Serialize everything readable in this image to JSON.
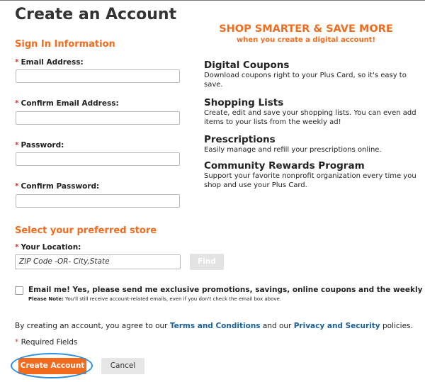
{
  "page": {
    "title": "Create an Account"
  },
  "sign_in": {
    "title": "Sign In Information",
    "email_label": "Email Address:",
    "confirm_email_label": "Confirm Email Address:",
    "password_label": "Password:",
    "confirm_password_label": "Confirm Password:"
  },
  "promo": {
    "headline": "SHOP SMARTER & SAVE MORE",
    "subheadline": "when you create a digital account!",
    "benefits": [
      {
        "title": "Digital Coupons",
        "text": "Download coupons right to your Plus Card, so it's easy to save."
      },
      {
        "title": "Shopping Lists",
        "text": "Create, edit and save your shopping lists. You can even add items to your lists from the weekly ad!"
      },
      {
        "title": "Prescriptions",
        "text": "Easily manage and refill your prescriptions online."
      },
      {
        "title": "Community Rewards Program",
        "text": "Support your favorite nonprofit organization every time you shop and use your Plus Card."
      }
    ]
  },
  "store": {
    "title": "Select your preferred store",
    "location_label": "Your Location:",
    "location_placeholder": "ZIP Code -OR- City,State",
    "find_label": "Find"
  },
  "email_opt": {
    "label": "Email me! Yes, please send me exclusive promotions, savings, online coupons and the weekly ad.",
    "note_prefix": "Please Note:",
    "note_text": "You'll still receive account-related emails, even if you don't check the email box above.",
    "checked": false
  },
  "terms": {
    "prefix": "By creating an account, you agree to our",
    "terms_link": "Terms and Conditions",
    "middle": "and our",
    "privacy_link": "Privacy and Security",
    "suffix": "policies."
  },
  "required_note": "Required Fields",
  "required_marker": "*",
  "buttons": {
    "create": "Create Account",
    "cancel": "Cancel"
  },
  "colors": {
    "accent": "#f26b1d",
    "link": "#1a5f99",
    "required": "#e0332f",
    "highlight": "#2b8fe0"
  }
}
